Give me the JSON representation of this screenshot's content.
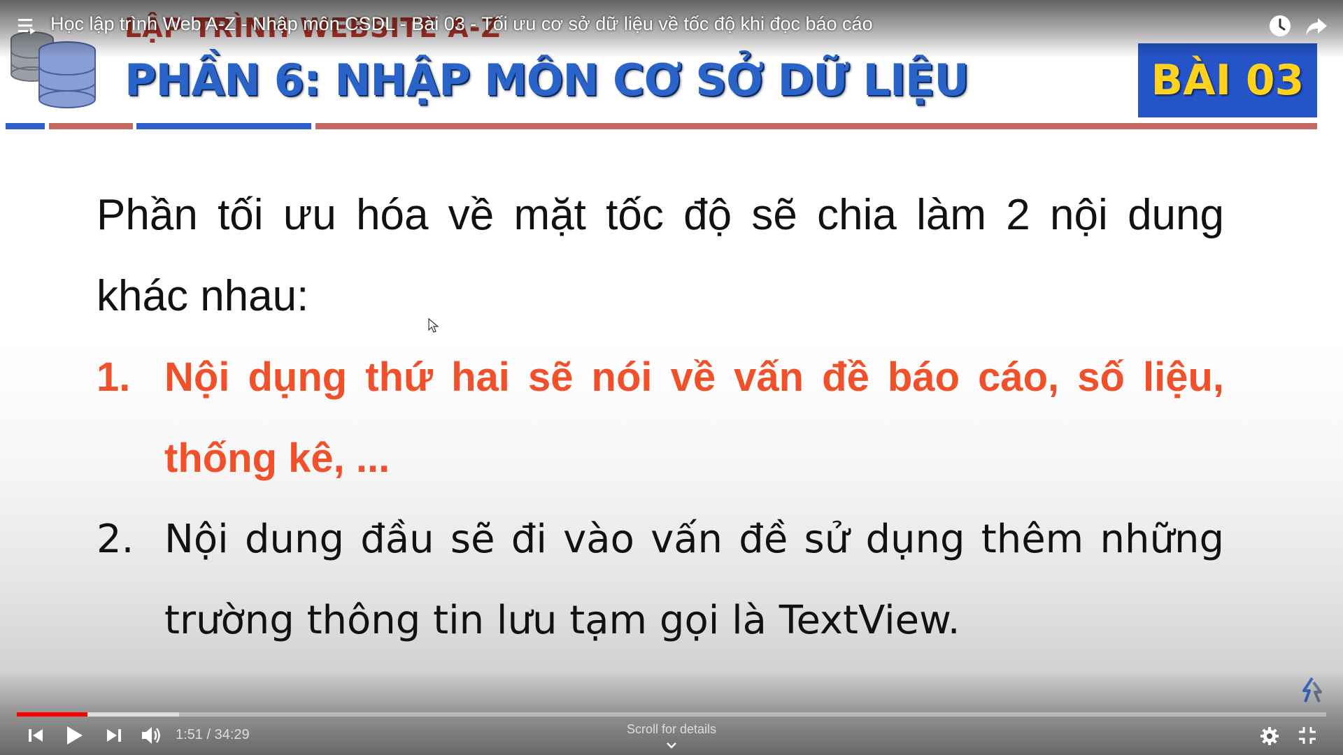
{
  "video": {
    "title": "Học lập trình Web A-Z - Nhập môn CSDL - Bài 03 - Tối ưu cơ sở dữ liệu về tốc độ khi đọc báo cáo"
  },
  "slide": {
    "subtitle": "LẬP TRÌNH WEBSITE A-Z",
    "title": "PHẦN 6: NHẬP MÔN CƠ SỞ DỮ LIỆU",
    "lesson_badge": "BÀI 03",
    "intro": "Phần tối ưu hóa về mặt tốc độ sẽ chia làm 2 nội dung khác nhau:",
    "items": [
      {
        "number": "1.",
        "text": "Nội dụng thứ hai sẽ nói về vấn đề báo cáo, số liệu, thống kê, ..."
      },
      {
        "number": "2.",
        "text": "Nội dung đầu sẽ đi vào vấn đề sử dụng thêm những trường thông tin lưu tạm gọi là TextView."
      }
    ]
  },
  "controls": {
    "time": "1:51 / 34:29",
    "scroll_hint": "Scroll for details",
    "played_fraction": 0.054,
    "buffered_fraction": 0.124
  },
  "icons": {
    "menu": "menu-icon",
    "watch_later": "clock-icon",
    "share": "share-icon",
    "previous": "skip-previous-icon",
    "play": "play-icon",
    "next": "skip-next-icon",
    "volume": "volume-icon",
    "settings": "gear-icon",
    "exit_fullscreen": "exit-fullscreen-icon",
    "watermark": "channel-watermark-icon"
  },
  "colors": {
    "progress_played": "#ff0000",
    "slide_title": "#2a64c8",
    "badge_bg": "#2454c8",
    "badge_text": "#ffd21e",
    "highlight_item": "#f0502a"
  }
}
